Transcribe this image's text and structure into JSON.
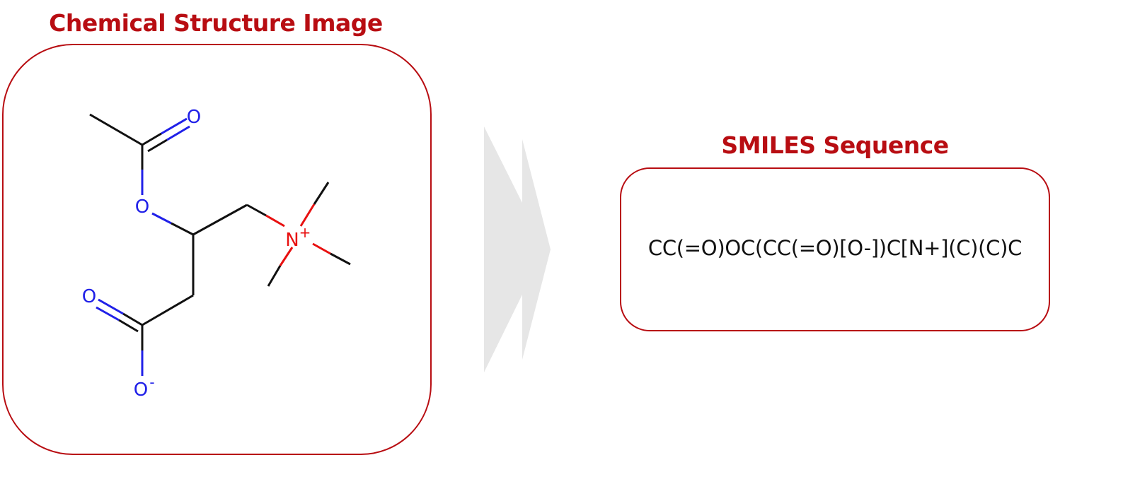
{
  "left_panel": {
    "title": "Chemical Structure Image",
    "atoms": {
      "carbonyl_oxygen_top": "O",
      "ester_oxygen": "O",
      "ammonium_nitrogen": "N",
      "ammonium_charge": "+",
      "carbonyl_oxygen_bottom": "O",
      "carboxylate_oxygen": "O",
      "carboxylate_charge": "-"
    }
  },
  "right_panel": {
    "title": "SMILES Sequence",
    "smiles": "CC(=O)OC(CC(=O)[O-])C[N+](C)(C)C"
  },
  "colors": {
    "accent": "#b80d12",
    "bond": "#111111",
    "oxygen": "#2020e8",
    "nitrogen": "#e81010",
    "arrow": "#e6e6e6"
  }
}
